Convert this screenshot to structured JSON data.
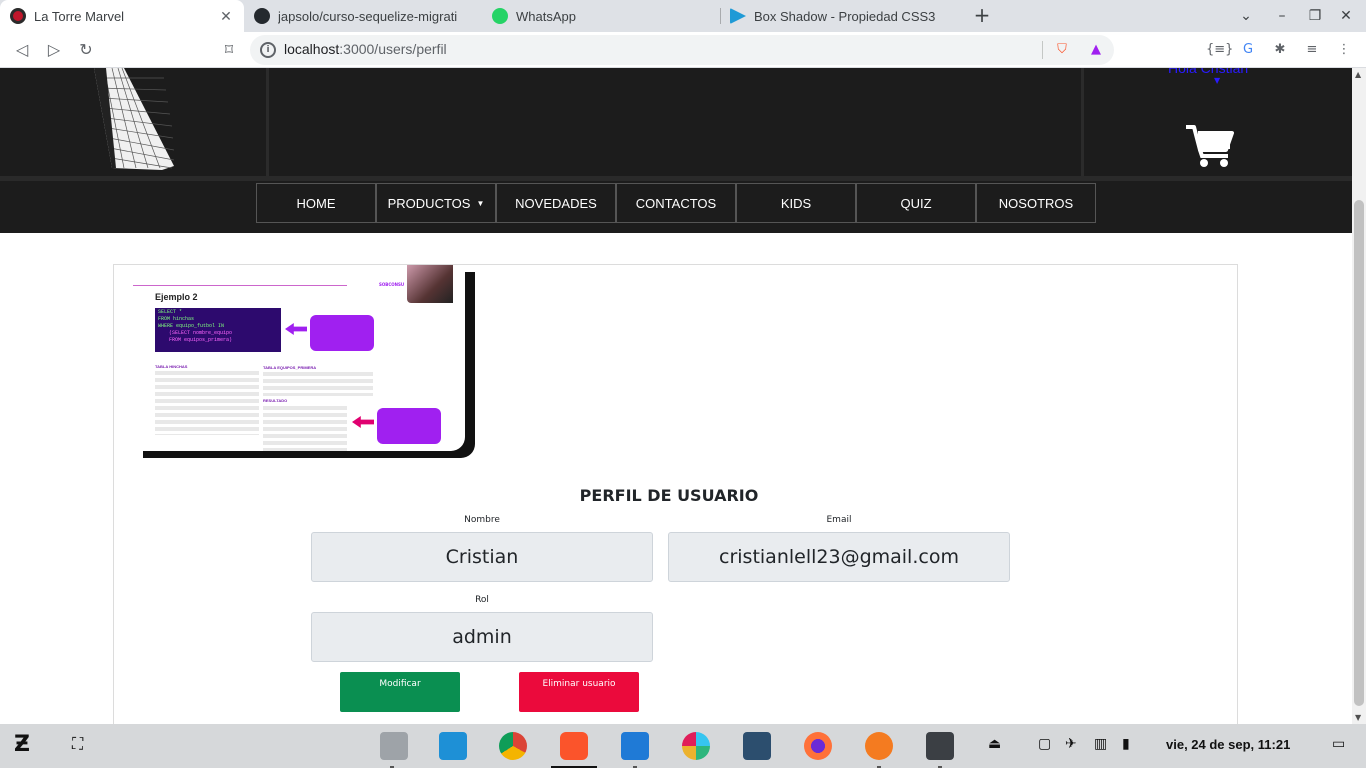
{
  "browser": {
    "tabs": [
      {
        "title": "La Torre Marvel",
        "active": true
      },
      {
        "title": "japsolo/curso-sequelize-migrati",
        "active": false
      },
      {
        "title": "WhatsApp",
        "active": false
      },
      {
        "title": "Box Shadow - Propiedad CSS3",
        "active": false
      }
    ],
    "new_tab": "+",
    "url_host": "localhost",
    "url_path": ":3000/users/perfil"
  },
  "header": {
    "user_greeting": "Hola Cristian",
    "cart_icon": "shopping-cart-icon"
  },
  "nav": {
    "items": [
      "HOME",
      "PRODUCTOS",
      "NOVEDADES",
      "CONTACTOS",
      "KIDS",
      "QUIZ",
      "NOSOTROS"
    ],
    "dropdown_index": 1
  },
  "profile_image": {
    "heading": "Ejemplo 2",
    "brand": "SOBCONSU",
    "sql_lines": [
      "SELECT *",
      "FROM hinchas",
      "WHERE equipo_futbol IN",
      "(SELECT nombre_equipo",
      "FROM equipos_primera)"
    ],
    "table1": "TABLA HINCHAS",
    "table2": "TABLA EQUIPOS_PRIMERA",
    "table3": "RESULTADO"
  },
  "profile": {
    "title": "PERFIL DE USUARIO",
    "nombre_label": "Nombre",
    "nombre_value": "Cristian",
    "email_label": "Email",
    "email_value": "cristianlell23@gmail.com",
    "rol_label": "Rol",
    "rol_value": "admin",
    "modify_button": "Modificar",
    "delete_button": "Eliminar usuario"
  },
  "taskbar": {
    "clock": "vie, 24 de sep, 11:21"
  },
  "colors": {
    "header_bg": "#1c1c1c",
    "greeting": "#2a1bff",
    "modify": "#0a8f51",
    "delete": "#eb0a3c"
  }
}
